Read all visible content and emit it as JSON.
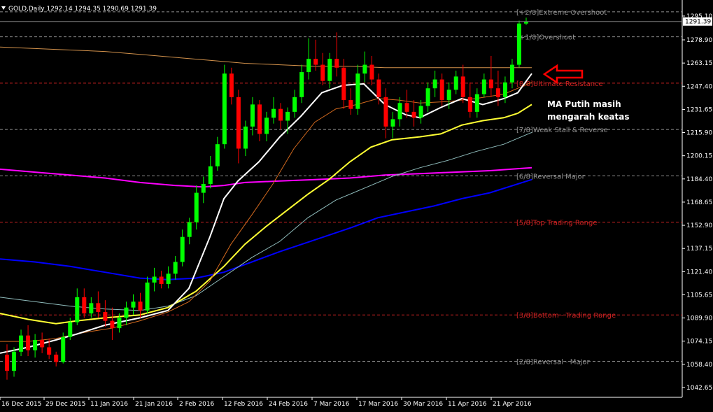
{
  "header": {
    "text": "GOLD,Daily  1292.14 1294.35 1290.69 1291.39"
  },
  "annotation": {
    "line1": "MA Putih masih",
    "line2": "mengarah keatas"
  },
  "colors": {
    "background": "#000000",
    "bull": "#00ff00",
    "bear": "#ff0000",
    "ma_white": "#ffffff",
    "ma_yellow": "#ffff33",
    "ma_orange_thin": "#d2691e",
    "ma_lightblue": "#8fbcbc",
    "ma_blue": "#0000ff",
    "ma_magenta": "#ff00ff",
    "ma_tan": "#d2914b",
    "arrow": "#ff0000"
  },
  "chart_data": {
    "type": "candlestick",
    "symbol": "GOLD",
    "timeframe": "Daily",
    "last_price": "1291.39",
    "ylim": [
      1036.0,
      1306.0
    ],
    "price_ticks": [
      "1295.10",
      "1278.90",
      "1263.15",
      "1247.40",
      "1231.65",
      "1215.90",
      "1200.15",
      "1184.40",
      "1168.65",
      "1152.90",
      "1137.15",
      "1121.40",
      "1105.65",
      "1089.90",
      "1074.15",
      "1058.40",
      "1042.65"
    ],
    "date_ticks": [
      "16 Dec 2015",
      "29 Dec 2015",
      "11 Jan 2016",
      "21 Jan 2016",
      "2 Feb 2016",
      "12 Feb 2016",
      "24 Feb 2016",
      "7 Mar 2016",
      "17 Mar 2016",
      "30 Mar 2016",
      "11 Apr 2016",
      "21 Apr 2016"
    ],
    "murrey_levels": [
      {
        "label": "[+2/8]Extreme Overshoot",
        "price": 1298.0,
        "color": "#909090"
      },
      {
        "label": "[+1/8]Overshoot",
        "price": 1281.0,
        "color": "#909090"
      },
      {
        "label": "[8/8]Ultimate Resistance",
        "price": 1249.5,
        "color": "#cc2222"
      },
      {
        "label": "[7/8]Weak Stall & Reverse",
        "price": 1218.0,
        "color": "#909090"
      },
      {
        "label": "[6/8]Reversal Major",
        "price": 1186.5,
        "color": "#909090"
      },
      {
        "label": "[5/8]Top Trading Range",
        "price": 1155.0,
        "color": "#cc2222"
      },
      {
        "label": "[3/8]Bottom - Trading Range",
        "price": 1092.0,
        "color": "#cc2222"
      },
      {
        "label": "[2/8]Reversal - Major",
        "price": 1060.5,
        "color": "#909090"
      }
    ],
    "ma_series": [
      {
        "color": "#d2914b",
        "points": [
          [
            0,
            1274
          ],
          [
            50,
            1273
          ],
          [
            100,
            1272
          ],
          [
            150,
            1271
          ],
          [
            200,
            1269
          ],
          [
            250,
            1267
          ],
          [
            300,
            1265
          ],
          [
            350,
            1263
          ],
          [
            400,
            1262
          ],
          [
            450,
            1261
          ],
          [
            500,
            1261
          ],
          [
            550,
            1260
          ],
          [
            600,
            1260
          ],
          [
            650,
            1260
          ],
          [
            700,
            1260
          ],
          [
            760,
            1260
          ]
        ]
      },
      {
        "color": "#ff00ff",
        "points": [
          [
            0,
            1191
          ],
          [
            50,
            1189
          ],
          [
            100,
            1187
          ],
          [
            150,
            1185
          ],
          [
            200,
            1182
          ],
          [
            250,
            1180
          ],
          [
            290,
            1179
          ],
          [
            320,
            1180
          ],
          [
            350,
            1182
          ],
          [
            400,
            1183
          ],
          [
            450,
            1184
          ],
          [
            500,
            1185
          ],
          [
            550,
            1187
          ],
          [
            600,
            1188
          ],
          [
            650,
            1189
          ],
          [
            700,
            1190
          ],
          [
            760,
            1192
          ]
        ]
      },
      {
        "color": "#0000ff",
        "points": [
          [
            0,
            1130
          ],
          [
            50,
            1128
          ],
          [
            100,
            1125
          ],
          [
            150,
            1121
          ],
          [
            200,
            1117
          ],
          [
            240,
            1116
          ],
          [
            280,
            1117
          ],
          [
            320,
            1121
          ],
          [
            360,
            1128
          ],
          [
            400,
            1135
          ],
          [
            450,
            1143
          ],
          [
            500,
            1151
          ],
          [
            540,
            1158
          ],
          [
            580,
            1162
          ],
          [
            620,
            1166
          ],
          [
            660,
            1171
          ],
          [
            700,
            1175
          ],
          [
            760,
            1184
          ]
        ]
      },
      {
        "color": "#8fbcbc",
        "points": [
          [
            0,
            1104
          ],
          [
            50,
            1101
          ],
          [
            100,
            1098
          ],
          [
            150,
            1096
          ],
          [
            200,
            1095
          ],
          [
            240,
            1098
          ],
          [
            280,
            1105
          ],
          [
            320,
            1118
          ],
          [
            360,
            1131
          ],
          [
            400,
            1142
          ],
          [
            440,
            1158
          ],
          [
            480,
            1170
          ],
          [
            520,
            1178
          ],
          [
            560,
            1186
          ],
          [
            600,
            1192
          ],
          [
            640,
            1197
          ],
          [
            680,
            1203
          ],
          [
            720,
            1208
          ],
          [
            760,
            1216
          ]
        ]
      },
      {
        "color": "#ffff33",
        "points": [
          [
            0,
            1093
          ],
          [
            40,
            1089
          ],
          [
            80,
            1086
          ],
          [
            110,
            1088
          ],
          [
            150,
            1090
          ],
          [
            200,
            1092
          ],
          [
            240,
            1097
          ],
          [
            280,
            1108
          ],
          [
            320,
            1125
          ],
          [
            350,
            1140
          ],
          [
            380,
            1152
          ],
          [
            410,
            1163
          ],
          [
            440,
            1174
          ],
          [
            470,
            1184
          ],
          [
            500,
            1196
          ],
          [
            530,
            1206
          ],
          [
            560,
            1211
          ],
          [
            600,
            1213
          ],
          [
            630,
            1215
          ],
          [
            660,
            1221
          ],
          [
            690,
            1224
          ],
          [
            720,
            1226
          ],
          [
            740,
            1229
          ],
          [
            760,
            1235
          ]
        ]
      },
      {
        "color": "#d2691e",
        "points": [
          [
            0,
            1074
          ],
          [
            40,
            1074
          ],
          [
            80,
            1076
          ],
          [
            120,
            1080
          ],
          [
            160,
            1083
          ],
          [
            200,
            1088
          ],
          [
            240,
            1094
          ],
          [
            270,
            1101
          ],
          [
            300,
            1115
          ],
          [
            330,
            1140
          ],
          [
            360,
            1160
          ],
          [
            390,
            1181
          ],
          [
            420,
            1205
          ],
          [
            450,
            1223
          ],
          [
            480,
            1232
          ],
          [
            510,
            1235
          ],
          [
            540,
            1239
          ],
          [
            570,
            1238
          ],
          [
            600,
            1236
          ],
          [
            640,
            1237
          ],
          [
            680,
            1239
          ],
          [
            720,
            1242
          ],
          [
            760,
            1250
          ]
        ]
      },
      {
        "color": "#ffffff",
        "points": [
          [
            0,
            1066
          ],
          [
            40,
            1070
          ],
          [
            80,
            1075
          ],
          [
            110,
            1079
          ],
          [
            150,
            1085
          ],
          [
            200,
            1090
          ],
          [
            240,
            1095
          ],
          [
            270,
            1110
          ],
          [
            300,
            1145
          ],
          [
            320,
            1171
          ],
          [
            340,
            1183
          ],
          [
            370,
            1196
          ],
          [
            400,
            1213
          ],
          [
            430,
            1227
          ],
          [
            460,
            1243
          ],
          [
            490,
            1248
          ],
          [
            520,
            1249
          ],
          [
            550,
            1235
          ],
          [
            580,
            1228
          ],
          [
            600,
            1226
          ],
          [
            630,
            1233
          ],
          [
            660,
            1239
          ],
          [
            690,
            1235
          ],
          [
            720,
            1239
          ],
          [
            740,
            1243
          ],
          [
            760,
            1256
          ]
        ]
      }
    ],
    "candles": [
      [
        1065,
        1072,
        1048,
        1054
      ],
      [
        1054,
        1070,
        1050,
        1067
      ],
      [
        1067,
        1082,
        1064,
        1078
      ],
      [
        1078,
        1085,
        1064,
        1068
      ],
      [
        1068,
        1079,
        1063,
        1075
      ],
      [
        1075,
        1080,
        1066,
        1070
      ],
      [
        1070,
        1076,
        1062,
        1065
      ],
      [
        1065,
        1067,
        1057,
        1060
      ],
      [
        1060,
        1080,
        1059,
        1077
      ],
      [
        1077,
        1090,
        1075,
        1087
      ],
      [
        1087,
        1110,
        1085,
        1104
      ],
      [
        1104,
        1110,
        1090,
        1093
      ],
      [
        1093,
        1104,
        1090,
        1100
      ],
      [
        1100,
        1108,
        1090,
        1094
      ],
      [
        1094,
        1102,
        1084,
        1088
      ],
      [
        1088,
        1097,
        1075,
        1083
      ],
      [
        1083,
        1093,
        1080,
        1090
      ],
      [
        1090,
        1101,
        1085,
        1097
      ],
      [
        1097,
        1106,
        1092,
        1101
      ],
      [
        1101,
        1107,
        1090,
        1095
      ],
      [
        1095,
        1118,
        1093,
        1114
      ],
      [
        1114,
        1124,
        1108,
        1118
      ],
      [
        1118,
        1122,
        1110,
        1113
      ],
      [
        1113,
        1125,
        1110,
        1120
      ],
      [
        1120,
        1132,
        1116,
        1128
      ],
      [
        1128,
        1150,
        1125,
        1145
      ],
      [
        1145,
        1158,
        1140,
        1155
      ],
      [
        1155,
        1180,
        1150,
        1175
      ],
      [
        1175,
        1186,
        1168,
        1181
      ],
      [
        1181,
        1200,
        1178,
        1193
      ],
      [
        1193,
        1213,
        1190,
        1208
      ],
      [
        1208,
        1262,
        1205,
        1256
      ],
      [
        1256,
        1260,
        1235,
        1240
      ],
      [
        1240,
        1245,
        1195,
        1205
      ],
      [
        1205,
        1224,
        1200,
        1220
      ],
      [
        1220,
        1240,
        1214,
        1235
      ],
      [
        1235,
        1238,
        1210,
        1215
      ],
      [
        1215,
        1230,
        1210,
        1226
      ],
      [
        1226,
        1240,
        1222,
        1232
      ],
      [
        1232,
        1236,
        1218,
        1224
      ],
      [
        1224,
        1233,
        1215,
        1230
      ],
      [
        1230,
        1245,
        1226,
        1240
      ],
      [
        1240,
        1262,
        1236,
        1257
      ],
      [
        1257,
        1280,
        1252,
        1266
      ],
      [
        1266,
        1279,
        1258,
        1262
      ],
      [
        1262,
        1270,
        1248,
        1251
      ],
      [
        1251,
        1270,
        1246,
        1266
      ],
      [
        1266,
        1284,
        1254,
        1260
      ],
      [
        1260,
        1266,
        1232,
        1238
      ],
      [
        1238,
        1246,
        1228,
        1232
      ],
      [
        1232,
        1262,
        1228,
        1256
      ],
      [
        1256,
        1271,
        1250,
        1262
      ],
      [
        1262,
        1268,
        1248,
        1252
      ],
      [
        1252,
        1256,
        1235,
        1240
      ],
      [
        1240,
        1246,
        1212,
        1220
      ],
      [
        1220,
        1230,
        1212,
        1225
      ],
      [
        1225,
        1240,
        1220,
        1236
      ],
      [
        1236,
        1245,
        1226,
        1230
      ],
      [
        1230,
        1238,
        1220,
        1226
      ],
      [
        1226,
        1238,
        1222,
        1234
      ],
      [
        1234,
        1250,
        1230,
        1246
      ],
      [
        1246,
        1258,
        1240,
        1252
      ],
      [
        1252,
        1256,
        1234,
        1238
      ],
      [
        1238,
        1250,
        1232,
        1245
      ],
      [
        1245,
        1258,
        1242,
        1254
      ],
      [
        1254,
        1262,
        1236,
        1240
      ],
      [
        1240,
        1250,
        1226,
        1230
      ],
      [
        1230,
        1246,
        1226,
        1242
      ],
      [
        1242,
        1256,
        1240,
        1252
      ],
      [
        1252,
        1268,
        1240,
        1246
      ],
      [
        1246,
        1258,
        1234,
        1240
      ],
      [
        1240,
        1254,
        1236,
        1250
      ],
      [
        1250,
        1266,
        1246,
        1262
      ],
      [
        1262,
        1292,
        1260,
        1290
      ],
      [
        1290,
        1294,
        1289,
        1291
      ]
    ]
  }
}
